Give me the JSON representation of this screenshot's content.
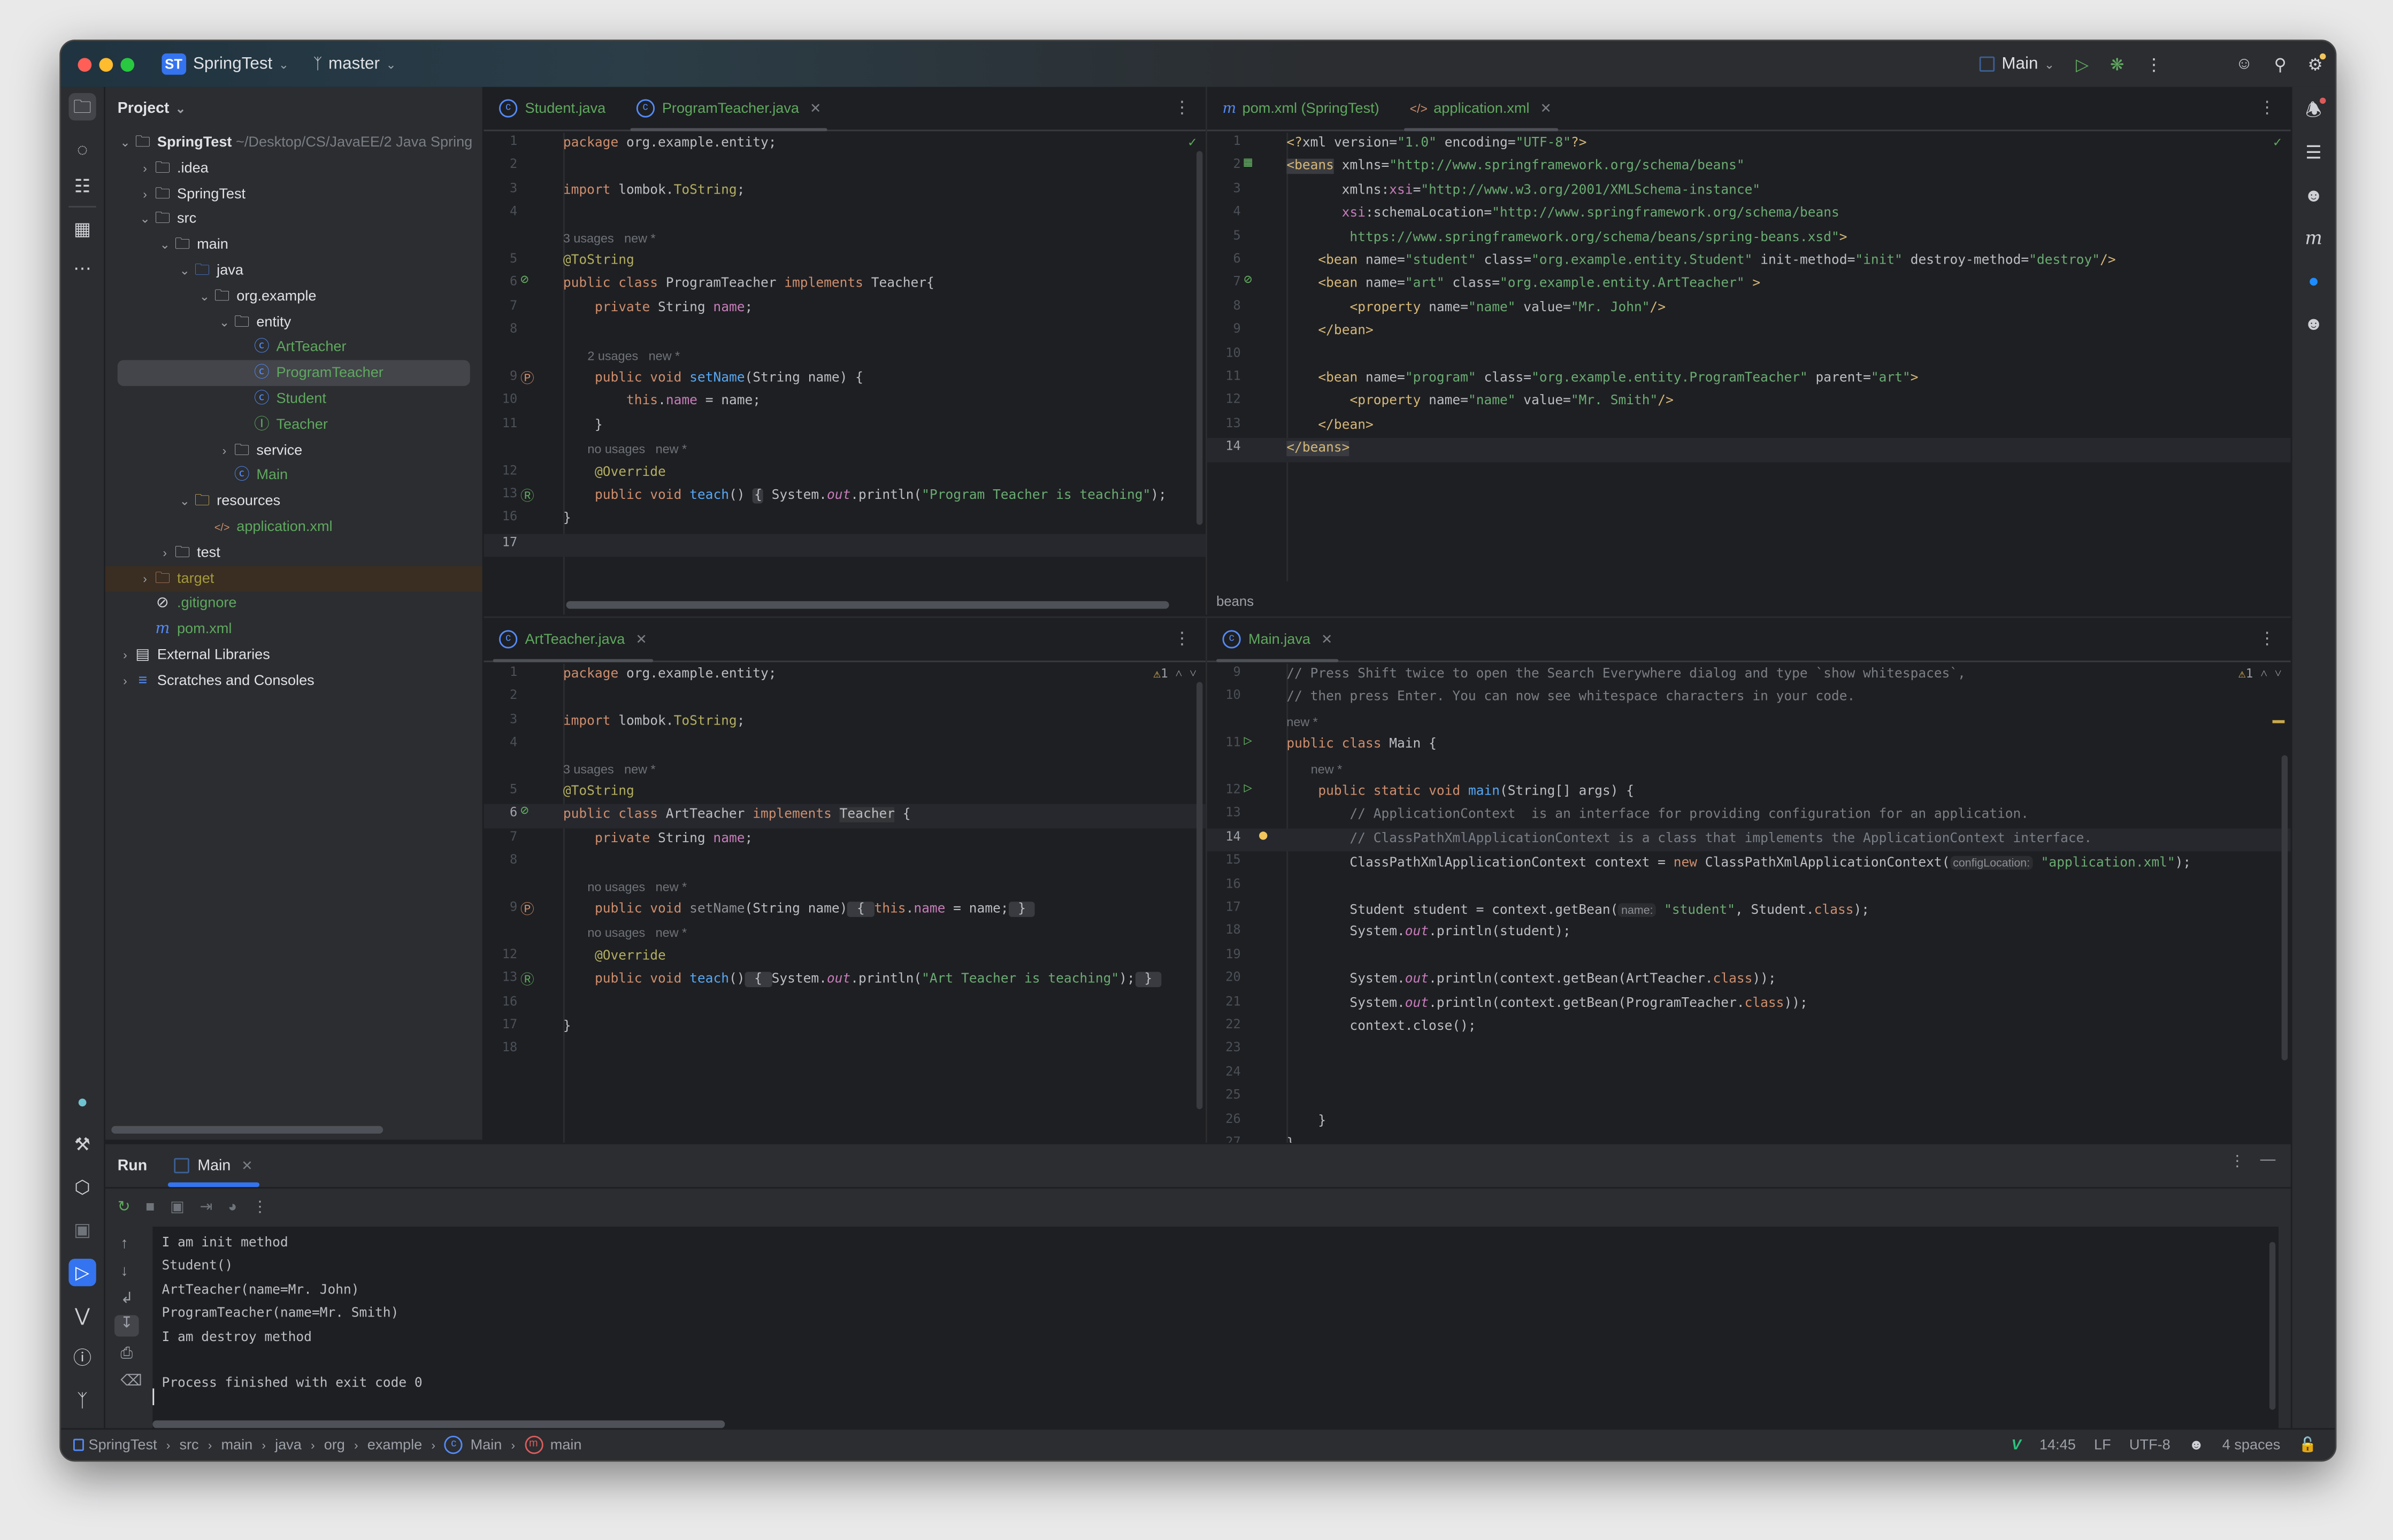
{
  "titlebar": {
    "project_badge": "ST",
    "project_name": "SpringTest",
    "branch": "master",
    "run_config": "Main",
    "colors": {
      "close": "#ff5f57",
      "minimize": "#febc2e",
      "maximize": "#28c840",
      "accent": "#3574f0"
    }
  },
  "project_panel": {
    "title": "Project",
    "tree": [
      {
        "label": "SpringTest",
        "extra": "~/Desktop/CS/JavaEE/2 Java Spring",
        "icon": "module-folder-icon",
        "depth": 0,
        "expanded": true,
        "bold": true
      },
      {
        "label": ".idea",
        "icon": "folder-icon",
        "depth": 1,
        "expanded": false
      },
      {
        "label": "SpringTest",
        "icon": "folder-icon",
        "depth": 1,
        "expanded": false
      },
      {
        "label": "src",
        "icon": "folder-icon",
        "depth": 1,
        "expanded": true
      },
      {
        "label": "main",
        "icon": "folder-icon",
        "depth": 2,
        "expanded": true
      },
      {
        "label": "java",
        "icon": "source-folder-icon",
        "depth": 3,
        "expanded": true
      },
      {
        "label": "org.example",
        "icon": "package-icon",
        "depth": 4,
        "expanded": true
      },
      {
        "label": "entity",
        "icon": "package-icon",
        "depth": 5,
        "expanded": true
      },
      {
        "label": "ArtTeacher",
        "icon": "class-icon",
        "depth": 6,
        "leaf": true
      },
      {
        "label": "ProgramTeacher",
        "icon": "class-icon",
        "depth": 6,
        "leaf": true,
        "selected": true
      },
      {
        "label": "Student",
        "icon": "class-icon",
        "depth": 6,
        "leaf": true
      },
      {
        "label": "Teacher",
        "icon": "interface-icon",
        "depth": 6,
        "leaf": true
      },
      {
        "label": "service",
        "icon": "package-icon",
        "depth": 5,
        "expanded": false
      },
      {
        "label": "Main",
        "icon": "class-icon",
        "depth": 5,
        "leaf": true
      },
      {
        "label": "resources",
        "icon": "resources-folder-icon",
        "depth": 3,
        "expanded": true
      },
      {
        "label": "application.xml",
        "icon": "spring-xml-icon",
        "depth": 4,
        "leaf": true
      },
      {
        "label": "test",
        "icon": "folder-icon",
        "depth": 2,
        "expanded": false
      },
      {
        "label": "target",
        "icon": "excluded-folder-icon",
        "depth": 1,
        "expanded": false,
        "excluded": true
      },
      {
        "label": ".gitignore",
        "icon": "ignore-file-icon",
        "depth": 1,
        "leaf": true
      },
      {
        "label": "pom.xml",
        "icon": "maven-icon",
        "depth": 1,
        "leaf": true
      },
      {
        "label": "External Libraries",
        "icon": "libraries-icon",
        "depth": 0,
        "expanded": false
      },
      {
        "label": "Scratches and Consoles",
        "icon": "scratches-icon",
        "depth": 0,
        "expanded": false
      }
    ]
  },
  "editors": {
    "top_left": {
      "tabs": [
        {
          "label": "Student.java",
          "active": false,
          "closable": false
        },
        {
          "label": "ProgramTeacher.java",
          "active": true,
          "closable": true
        }
      ],
      "status": "ok"
    },
    "top_right": {
      "tabs": [
        {
          "label": "pom.xml (SpringTest)",
          "active": false,
          "closable": false
        },
        {
          "label": "application.xml",
          "active": true,
          "closable": true
        }
      ],
      "status": "ok",
      "breadcrumb": "beans"
    },
    "bottom_left": {
      "tabs": [
        {
          "label": "ArtTeacher.java",
          "active": true,
          "closable": true
        }
      ],
      "warnings": "1"
    },
    "bottom_right": {
      "tabs": [
        {
          "label": "Main.java",
          "active": true,
          "closable": true
        }
      ],
      "warnings": "1"
    }
  },
  "inlay": {
    "usages3": "3 usages",
    "usages2": "2 usages",
    "nousages": "no usages",
    "new": "new *",
    "configLocation": "configLocation:",
    "name": "name:"
  },
  "run_panel": {
    "title": "Run",
    "tab": "Main",
    "output": [
      "I am init method",
      "Student()",
      "ArtTeacher(name=Mr. John)",
      "ProgramTeacher(name=Mr. Smith)",
      "I am destroy method",
      "",
      "Process finished with exit code 0"
    ]
  },
  "statusbar": {
    "breadcrumbs": [
      "SpringTest",
      "src",
      "main",
      "java",
      "org",
      "example",
      "Main",
      "main"
    ],
    "position": "14:45",
    "line_separator": "LF",
    "encoding": "UTF-8",
    "indent": "4 spaces"
  }
}
